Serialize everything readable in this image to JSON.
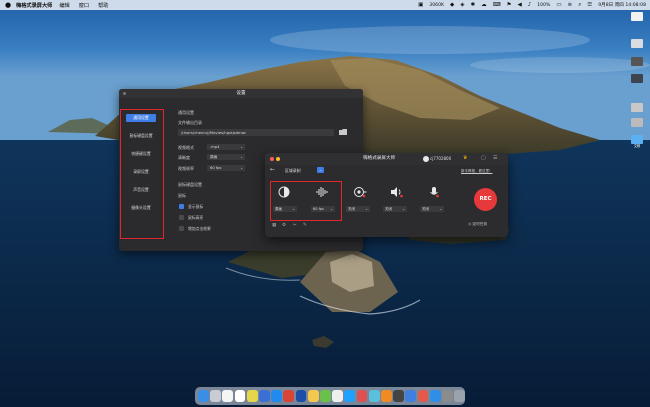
{
  "menubar": {
    "apple": "",
    "app_name": "嗨格式录屏大师",
    "items": [
      "编辑",
      "窗口",
      "帮助"
    ],
    "net_speed": "3060K",
    "battery": "100%",
    "date_time": "9月8日 周四  14:08:08"
  },
  "desktop_icons": [
    "",
    "",
    "",
    "",
    "",
    "",
    "文稿"
  ],
  "settings": {
    "title": "设置",
    "nav": [
      "通用设置",
      "鼠标键盘设置",
      "快捷键设置",
      "录屏设置",
      "声音设置",
      "摄像头设置"
    ],
    "active_nav": 0,
    "heading": "通用设置",
    "output_dir_label": "文件输出目录",
    "output_dir": "/Users/chenruJ/Movies/hgstjsdmac",
    "video_format_label": "视频格式",
    "video_format": ".mp4",
    "clarity_label": "清晰度",
    "clarity": "原画",
    "frame_rate_label": "视频帧率",
    "frame_rate": "60 fps",
    "mouse_heading": "鼠标键盘设置",
    "mouse_label": "鼠标",
    "opts": [
      {
        "label": "显示鼠标",
        "checked": true
      },
      {
        "label": "鼠标高亮",
        "checked": false
      },
      {
        "label": "增加点击效果",
        "checked": false
      }
    ]
  },
  "recorder": {
    "title": "嗨格式录屏大师",
    "account": "cj7702800",
    "mode_label": "区域录制",
    "help_link": "新手教程，看这里！",
    "clarity_dd": "原画",
    "fps_dd": "60 fps",
    "cam_dd": "关闭",
    "sys_audio_dd": "关闭",
    "mic_dd": "关闭",
    "rec_label": "REC",
    "schedule": "定时任务"
  },
  "colors": {
    "accent_blue": "#3e7ee6",
    "rec_red": "#e5393b",
    "highlight_red": "#e3262c"
  }
}
